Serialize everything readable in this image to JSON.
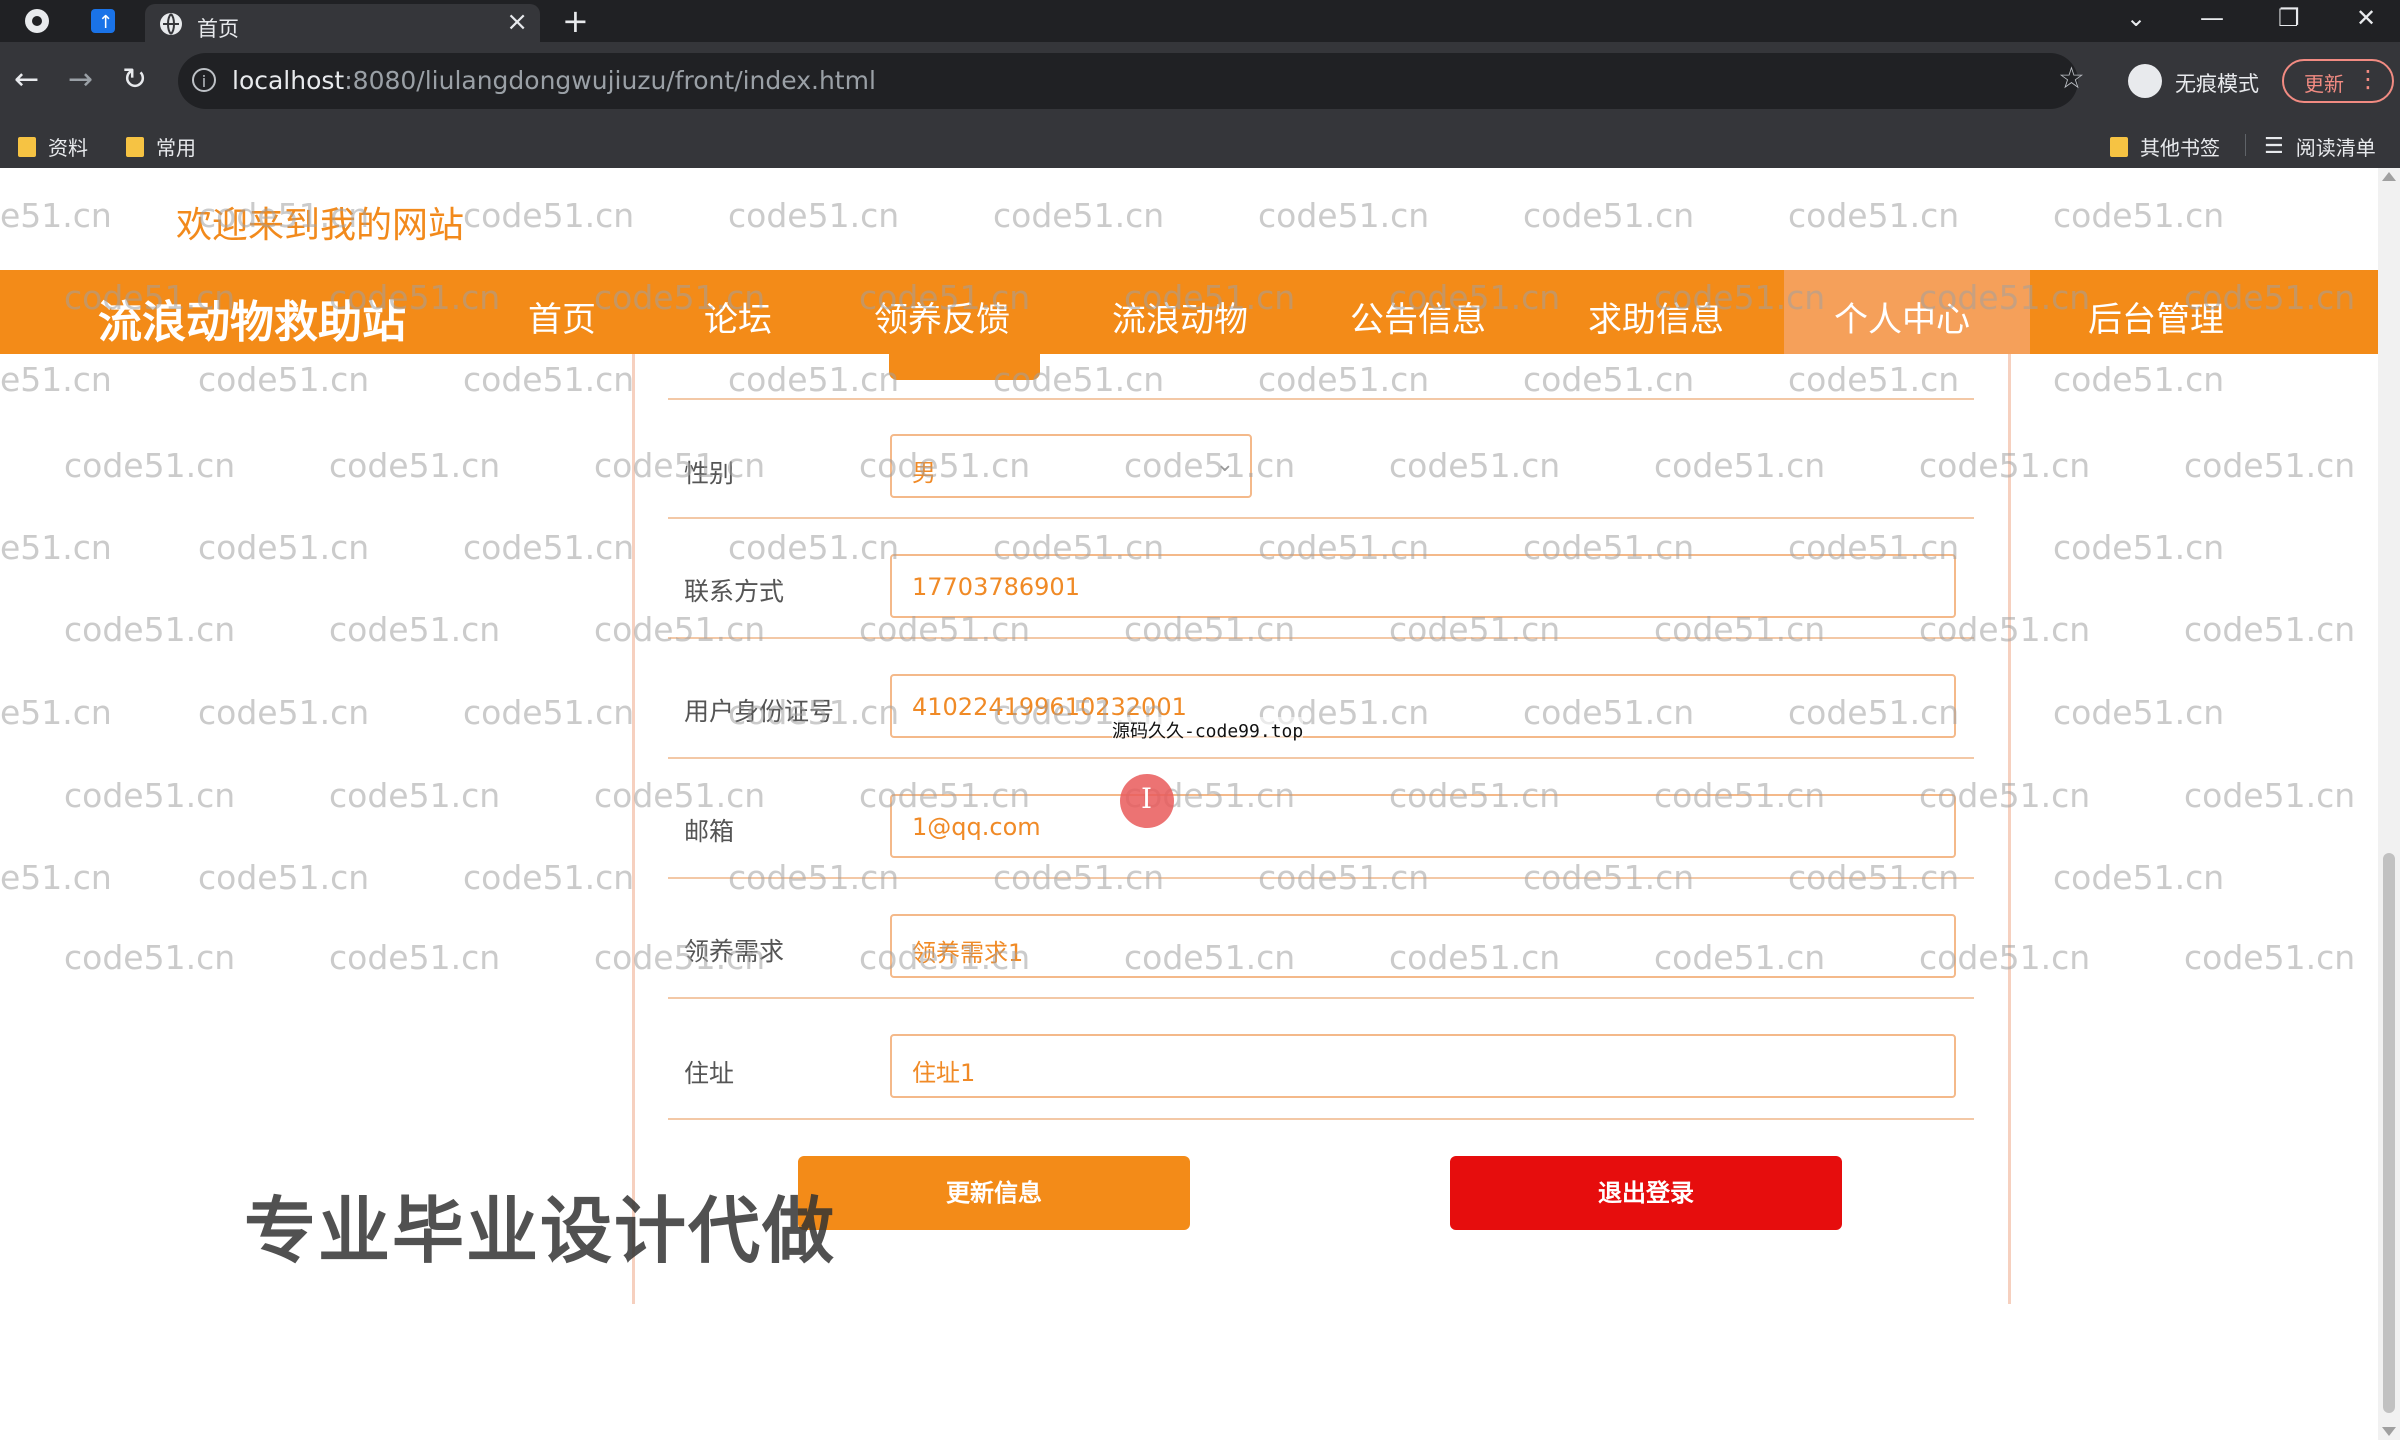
{
  "browser": {
    "tab_title": "首页",
    "tab_close": "×",
    "new_tab": "+",
    "url_host": "localhost",
    "url_path": ":8080/liulangdongwujiuzu/front/index.html",
    "incognito_label": "无痕模式",
    "update_label": "更新",
    "update_menu": "⋮",
    "bookmarks": [
      "资料",
      "常用"
    ],
    "bookmarks_right": [
      "其他书签",
      "阅读清单"
    ],
    "window_controls": [
      "⌄",
      "—",
      "❐",
      "✕"
    ]
  },
  "page": {
    "welcome": "欢迎来到我的网站",
    "site_title": "流浪动物救助站",
    "nav": [
      "首页",
      "论坛",
      "领养反馈",
      "流浪动物",
      "公告信息",
      "求助信息",
      "个人中心",
      "后台管理"
    ],
    "nav_active": "个人中心",
    "form": {
      "gender_label": "性别",
      "gender_value": "男",
      "phone_label": "联系方式",
      "phone_value": "17703786901",
      "idcard_label": "用户身份证号",
      "idcard_value": "410224199610232001",
      "email_label": "邮箱",
      "email_value": "1@qq.com",
      "need_label": "领养需求",
      "need_value": "领养需求1",
      "address_label": "住址",
      "address_value": "住址1"
    },
    "buttons": {
      "update": "更新信息",
      "logout": "退出登录"
    },
    "overlay_tag": "源码久久-code99.top",
    "promo_text": "专业毕业设计代做",
    "watermark": "code51.cn",
    "watermark_partial_left": "e51.cn",
    "watermark_partial_right": "code"
  },
  "colors": {
    "brand_orange": "#f38b18",
    "logout_red": "#e60d0d",
    "value_orange": "#f08a26"
  }
}
